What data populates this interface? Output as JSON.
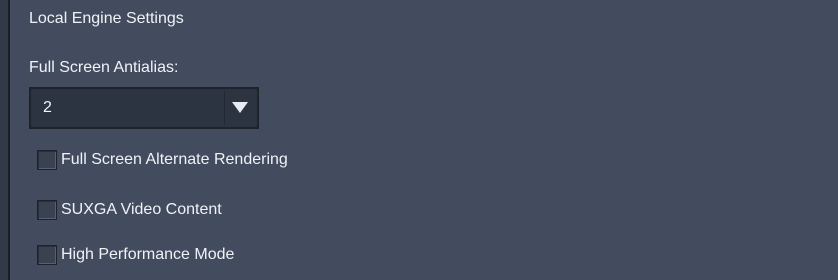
{
  "section": {
    "title": "Local Engine Settings"
  },
  "antialias": {
    "label": "Full Screen Antialias:",
    "selected": "2"
  },
  "options": [
    {
      "label": "Full Screen Alternate Rendering",
      "checked": false
    },
    {
      "label": "SUXGA Video Content",
      "checked": false
    },
    {
      "label": "High Performance Mode",
      "checked": false
    }
  ],
  "icons": {
    "dropdown_arrow": "chevron-down-icon"
  },
  "colors": {
    "background": "#434c5e",
    "field_background": "#2c3341",
    "text": "#f0f2f6"
  }
}
